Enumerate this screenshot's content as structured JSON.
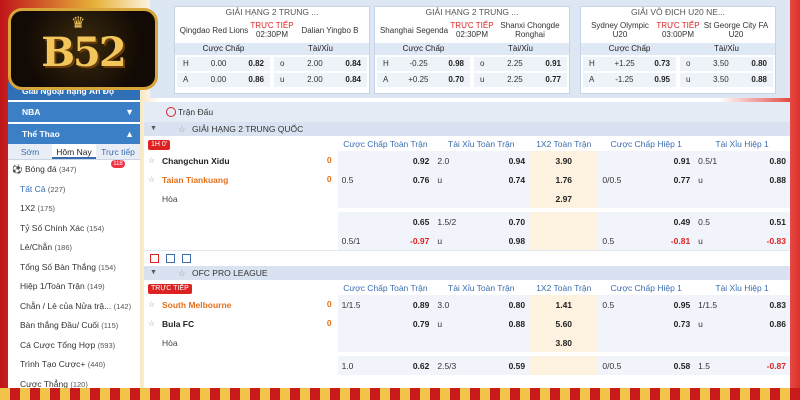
{
  "logo": {
    "text": "B52"
  },
  "top_matches": [
    {
      "league": "GIẢI HẠNG 2 TRUNG ...",
      "home": "Qingdao Red Lions",
      "away": "Dalian Yingbo B",
      "status": "TRỰC TIẾP",
      "time": "02:30PM",
      "h_line": "0.00",
      "h_odds": "0.82",
      "h_ou": "2.00",
      "h_ou_odds": "0.84",
      "a_line": "0.00",
      "a_odds": "0.86",
      "a_ou": "2.00",
      "a_ou_odds": "0.84"
    },
    {
      "league": "GIẢI HẠNG 2 TRUNG ...",
      "home": "Shanghai Segenda",
      "away": "Shanxi Chongde Ronghai",
      "status": "TRỰC TIẾP",
      "time": "02:30PM",
      "h_line": "-0.25",
      "h_odds": "0.98",
      "h_ou": "2.25",
      "h_ou_odds": "0.91",
      "a_line": "+0.25",
      "a_odds": "0.70",
      "a_ou": "2.25",
      "a_ou_odds": "0.77"
    },
    {
      "league": "GIẢI VÔ ĐỊCH U20 NE...",
      "home": "Sydney Olympic U20",
      "away": "St George City FA U20",
      "status": "TRỰC TIẾP",
      "time": "03:00PM",
      "h_line": "+1.25",
      "h_odds": "0.73",
      "h_ou": "3.50",
      "h_ou_odds": "0.80",
      "a_line": "-1.25",
      "a_odds": "0.95",
      "a_ou": "3.50",
      "a_ou_odds": "0.88"
    }
  ],
  "card_labels": {
    "hdp": "Cược Chấp",
    "ou": "Tài/Xỉu",
    "h": "H",
    "a": "A",
    "o": "o",
    "u": "u"
  },
  "sidebar": {
    "league_label": "Giải Ngoại hạng Ấn Độ",
    "nba_label": "NBA",
    "sport_label": "Thể Thao",
    "tabs": [
      "Sớm",
      "Hôm Nay",
      "Trực tiếp"
    ],
    "live_badge": "118",
    "items": [
      {
        "label": "Bóng đá",
        "count": "(347)"
      },
      {
        "label": "Tất Cả",
        "count": "(227)"
      },
      {
        "label": "1X2",
        "count": "(175)"
      },
      {
        "label": "Tỷ Số Chính Xác",
        "count": "(154)"
      },
      {
        "label": "Lẻ/Chẵn",
        "count": "(186)"
      },
      {
        "label": "Tổng Số Bàn Thắng",
        "count": "(154)"
      },
      {
        "label": "Hiệp 1/Toàn Trận",
        "count": "(149)"
      },
      {
        "label": "Chẵn / Lẻ của Nửa trậ...",
        "count": "(142)"
      },
      {
        "label": "Bàn thắng Đầu/ Cuối",
        "count": "(115)"
      },
      {
        "label": "Cá Cược Tổng Hợp",
        "count": "(593)"
      },
      {
        "label": "Trình Tạo Cược+",
        "count": "(440)"
      },
      {
        "label": "Cược Thẳng",
        "count": "(120)"
      }
    ]
  },
  "main": {
    "title": "Trận Đấu",
    "headers": [
      "Cược Chấp Toàn Trận",
      "Tài Xỉu Toàn Trận",
      "1X2 Toàn Trận",
      "Cược Chấp Hiệp 1",
      "Tài Xỉu Hiệp 1"
    ],
    "leagues": [
      {
        "name": "GIẢI HẠNG 2 TRUNG QUỐC",
        "live_label": "1H 0'",
        "home": "Changchun Xidu",
        "home_score": "0",
        "away": "Taian Tiankuang",
        "away_score": "0",
        "draw": "Hòa",
        "r1": {
          "hdp_l": "",
          "hdp_v": "0.92",
          "ou_l": "2.0",
          "ou_v": "0.94",
          "x12": "3.90",
          "h1_l": "",
          "h1_v": "0.91",
          "h1ou_l": "0.5/1",
          "h1ou_v": "0.80"
        },
        "r2": {
          "hdp_l": "0.5",
          "hdp_v": "0.76",
          "ou_l": "u",
          "ou_v": "0.74",
          "x12": "1.76",
          "h1_l": "0/0.5",
          "h1_v": "0.77",
          "h1ou_l": "u",
          "h1ou_v": "0.88"
        },
        "r3": {
          "x12": "2.97"
        },
        "r4": {
          "hdp_l": "",
          "hdp_v": "0.65",
          "ou_l": "1.5/2",
          "ou_v": "0.70",
          "h1_l": "",
          "h1_v": "0.49",
          "h1ou_l": "0.5",
          "h1ou_v": "0.51"
        },
        "r5": {
          "hdp_l": "0.5/1",
          "hdp_v": "-0.97",
          "ou_l": "u",
          "ou_v": "0.98",
          "h1_l": "0.5",
          "h1_v": "-0.81",
          "h1ou_l": "u",
          "h1ou_v": "-0.83"
        }
      },
      {
        "name": "OFC PRO LEAGUE",
        "live_label": "TRỰC TIẾP",
        "home": "South Melbourne",
        "home_score": "0",
        "away": "Bula FC",
        "away_score": "0",
        "draw": "Hòa",
        "r1": {
          "hdp_l": "1/1.5",
          "hdp_v": "0.89",
          "ou_l": "3.0",
          "ou_v": "0.80",
          "x12": "1.41",
          "h1_l": "0.5",
          "h1_v": "0.95",
          "h1ou_l": "1/1.5",
          "h1ou_v": "0.83"
        },
        "r2": {
          "hdp_l": "",
          "hdp_v": "0.79",
          "ou_l": "u",
          "ou_v": "0.88",
          "x12": "5.60",
          "h1_l": "",
          "h1_v": "0.73",
          "h1ou_l": "u",
          "h1ou_v": "0.86"
        },
        "r3": {
          "x12": "3.80"
        },
        "r4": {
          "hdp_l": "1.0",
          "hdp_v": "0.62",
          "ou_l": "2.5/3",
          "ou_v": "0.59",
          "h1_l": "0/0.5",
          "h1_v": "0.58",
          "h1ou_l": "1.5",
          "h1ou_v": "-0.87"
        }
      }
    ]
  }
}
